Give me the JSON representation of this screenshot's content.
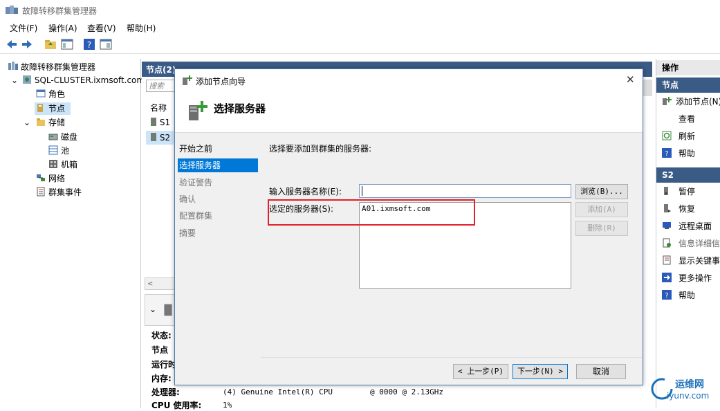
{
  "window": {
    "title": "故障转移群集管理器"
  },
  "menu": [
    "文件(F)",
    "操作(A)",
    "查看(V)",
    "帮助(H)"
  ],
  "tree": {
    "root": "故障转移群集管理器",
    "cluster": "SQL-CLUSTER.ixmsoft.com",
    "items": [
      "角色",
      "节点",
      "存储",
      "磁盘",
      "池",
      "机箱",
      "网络",
      "群集事件"
    ]
  },
  "middle": {
    "header": "节点(2)",
    "search_placeholder": "搜索",
    "column_name": "名称",
    "rows": [
      "S1",
      "S2"
    ],
    "details_labels": [
      "状态:",
      "节点",
      "运行时",
      "内存:",
      "处理器:",
      "CPU 使用率:"
    ],
    "processor_value": "(4) Genuine Intel(R) CPU",
    "processor_freq": "@ 0000 @ 2.13GHz",
    "cpu_value": "1%"
  },
  "actions": {
    "header": "操作",
    "section1": "节点",
    "items1": [
      "添加节点(N)...",
      "查看",
      "刷新",
      "帮助"
    ],
    "section2": "S2",
    "items2": [
      "暂停",
      "恢复",
      "远程桌面",
      "信息详细信息",
      "显示关键事件",
      "更多操作",
      "帮助"
    ]
  },
  "dialog": {
    "title": "添加节点向导",
    "heading": "选择服务器",
    "steps": [
      "开始之前",
      "选择服务器",
      "验证警告",
      "确认",
      "配置群集",
      "摘要"
    ],
    "instruction": "选择要添加到群集的服务器:",
    "enter_label": "输入服务器名称(E):",
    "enter_value": "",
    "selected_label": "选定的服务器(S):",
    "selected_servers": [
      "A01.ixmsoft.com"
    ],
    "browse_label": "浏览(B)...",
    "add_label": "添加(A)",
    "remove_label": "删除(R)",
    "back_label": "< 上一步(P)",
    "next_label": "下一步(N) >",
    "cancel_label": "取消",
    "close_glyph": "✕"
  },
  "watermark": {
    "line1": "运维网",
    "line2": "iyunv.com"
  },
  "colors": {
    "highlight": "#e0202a",
    "accent": "#0078d7",
    "selection": "#cce4f7",
    "header_bar": "#3a5b86"
  }
}
